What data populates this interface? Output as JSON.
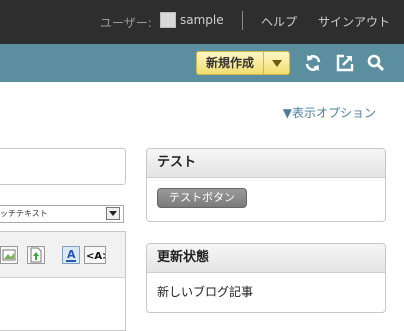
{
  "topbar": {
    "user_label": "ユーザー:",
    "username": "sample",
    "help": "ヘルプ",
    "signout": "サインアウト"
  },
  "toolbar": {
    "new_button": "新規作成",
    "icons": [
      "refresh-icon",
      "external-link-icon",
      "search-icon"
    ]
  },
  "view_options": "▼表示オプション",
  "editor": {
    "mode_select": "ッチテキスト"
  },
  "panels": {
    "test": {
      "title": "テスト",
      "button": "テストボタン"
    },
    "status": {
      "title": "更新状態",
      "text": "新しいブログ記事"
    }
  },
  "colors": {
    "topbar": "#2e2e2e",
    "toolbar": "#5b8fa0",
    "accent_button": "#f1dd6f",
    "link": "#4c7f9a"
  }
}
